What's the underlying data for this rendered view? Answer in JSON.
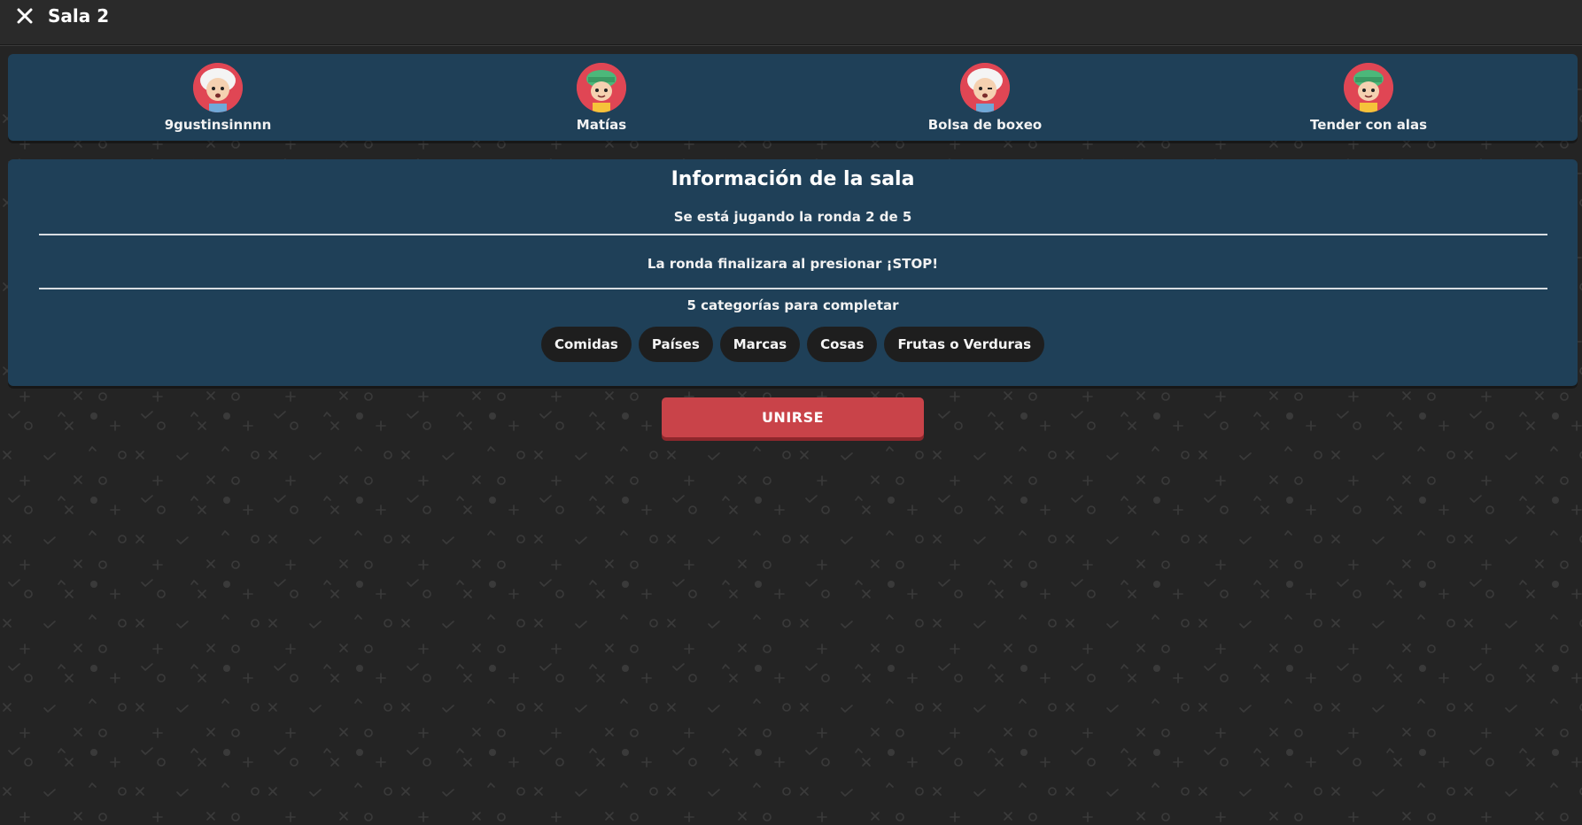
{
  "header": {
    "title": "Sala 2",
    "close_icon": "close-icon"
  },
  "players": [
    {
      "name": "9gustinsinnnn",
      "avatar": "old-man-avatar",
      "avatar_bg": "#e04654"
    },
    {
      "name": "Matías",
      "avatar": "towel-head-avatar",
      "avatar_bg": "#e04654"
    },
    {
      "name": "Bolsa de boxeo",
      "avatar": "old-man-avatar",
      "avatar_bg": "#e04654"
    },
    {
      "name": "Tender con alas",
      "avatar": "towel-head-avatar",
      "avatar_bg": "#e04654"
    }
  ],
  "room_info": {
    "title": "Información de la sala",
    "round_text": "Se está jugando la ronda 2 de 5",
    "end_text": "La ronda finalizara al presionar ¡STOP!",
    "categories_text": "5 categorías para completar",
    "categories": [
      "Comidas",
      "Países",
      "Marcas",
      "Cosas",
      "Frutas o Verduras"
    ]
  },
  "join_button": {
    "label": "UNIRSE"
  },
  "colors": {
    "background": "#242424",
    "panel": "#1f4058",
    "accent": "#c94349",
    "chip": "#1e1e1e"
  }
}
